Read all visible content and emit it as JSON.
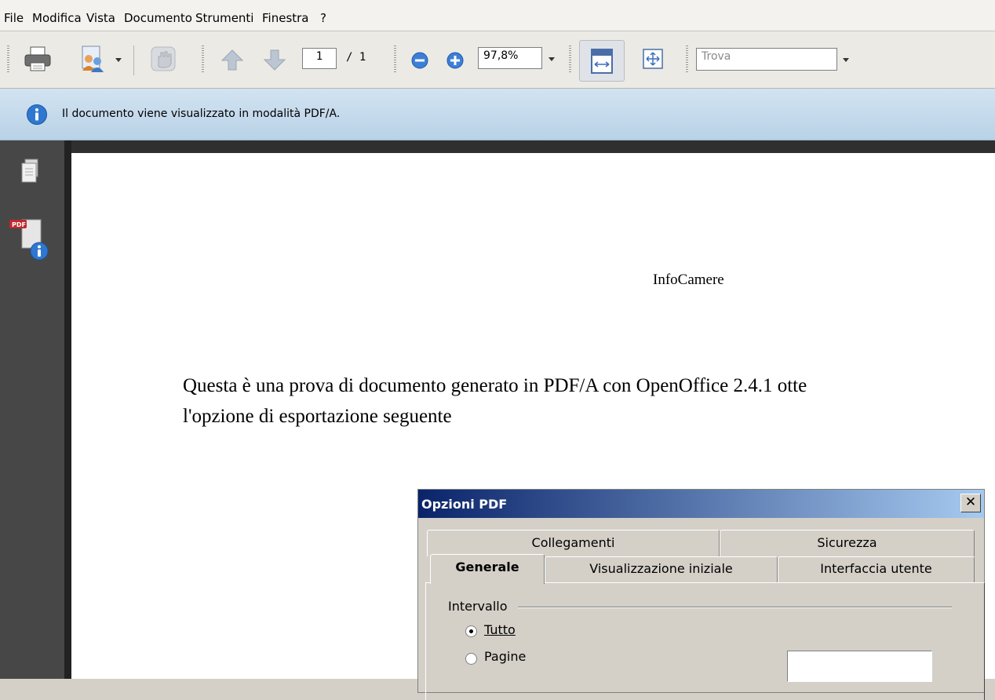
{
  "menu": [
    "File",
    "Modifica",
    "Vista",
    "Documento",
    "Strumenti",
    "Finestra",
    "?"
  ],
  "toolbar": {
    "page_current": "1",
    "page_total": "/ 1",
    "zoom": "97,8%",
    "find_placeholder": "Trova"
  },
  "infobar": {
    "message": "Il documento viene visualizzato in modalità PDF/A."
  },
  "document": {
    "header": "InfoCamere",
    "line1": "Questa è una prova di documento generato in PDF/A con OpenOffice 2.4.1 otte",
    "line2": "l'opzione di esportazione seguente"
  },
  "dialog": {
    "title": "Opzioni PDF",
    "close": "✕",
    "tabs_back": [
      "Collegamenti",
      "Sicurezza"
    ],
    "tabs_front": [
      "Generale",
      "Visualizzazione iniziale",
      "Interfaccia utente"
    ],
    "group_label": "Intervallo",
    "radio_all": "Tutto",
    "radio_pages": "Pagine",
    "pages_value": ""
  },
  "icons": {
    "print": "printer-icon",
    "users": "collaborate-icon",
    "hand": "hand-icon",
    "up": "arrow-up-icon",
    "down": "arrow-down-icon",
    "zoom_out": "zoom-out-icon",
    "zoom_in": "zoom-in-icon",
    "fit_width": "fit-width-icon",
    "fit_page": "fit-page-icon",
    "info": "info-icon",
    "pages": "pages-panel-icon",
    "pdf_info": "pdfa-info-icon"
  },
  "colors": {
    "info_bg": "#c5dbed",
    "sidebar": "#474747",
    "title_start": "#0a246a",
    "title_end": "#a6caf0"
  }
}
